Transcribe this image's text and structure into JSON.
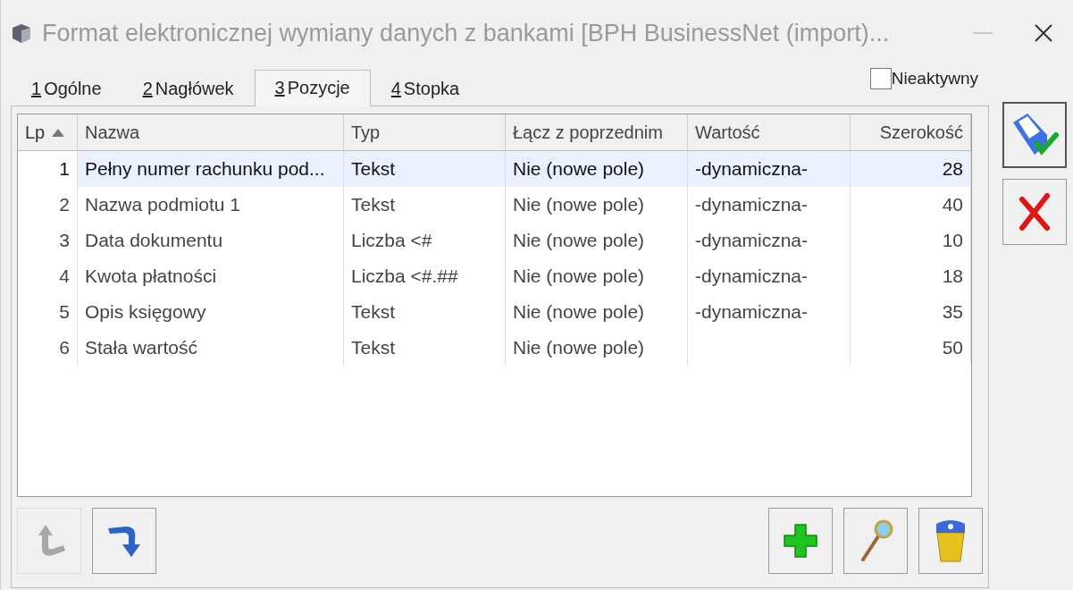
{
  "window": {
    "title": "Format elektronicznej wymiany danych z bankami [BPH BusinessNet (import)..."
  },
  "tabs": [
    {
      "key": "1",
      "label": "Ogólne",
      "selected": false
    },
    {
      "key": "2",
      "label": "Nagłówek",
      "selected": false
    },
    {
      "key": "3",
      "label": "Pozycje",
      "selected": true
    },
    {
      "key": "4",
      "label": "Stopka",
      "selected": false
    }
  ],
  "inactive_checkbox": {
    "label": "Nieaktywny",
    "checked": false
  },
  "table": {
    "columns": [
      {
        "label": "Lp",
        "sorted": true
      },
      {
        "label": "Nazwa",
        "sorted": false
      },
      {
        "label": "Typ",
        "sorted": false
      },
      {
        "label": "Łącz z poprzednim",
        "sorted": false
      },
      {
        "label": "Wartość",
        "sorted": false
      },
      {
        "label": "Szerokość",
        "sorted": false
      }
    ],
    "rows": [
      {
        "selected": true,
        "cells": [
          "1",
          "Pełny numer rachunku pod...",
          "Tekst",
          "Nie (nowe pole)",
          "-dynamiczna-",
          "28"
        ]
      },
      {
        "selected": false,
        "cells": [
          "2",
          "Nazwa podmiotu 1",
          "Tekst",
          "Nie (nowe pole)",
          "-dynamiczna-",
          "40"
        ]
      },
      {
        "selected": false,
        "cells": [
          "3",
          "Data dokumentu",
          "Liczba <#",
          "Nie (nowe pole)",
          "-dynamiczna-",
          "10"
        ]
      },
      {
        "selected": false,
        "cells": [
          "4",
          "Kwota płatności",
          "Liczba <#.##",
          "Nie (nowe pole)",
          "-dynamiczna-",
          "18"
        ]
      },
      {
        "selected": false,
        "cells": [
          "5",
          "Opis księgowy",
          "Tekst",
          "Nie (nowe pole)",
          "-dynamiczna-",
          "35"
        ]
      },
      {
        "selected": false,
        "cells": [
          "6",
          "Stała wartość",
          "Tekst",
          "Nie (nowe pole)",
          "",
          "50"
        ]
      }
    ]
  },
  "bottom_buttons": [
    {
      "kind": "up",
      "disabled": true
    },
    {
      "kind": "down",
      "disabled": false
    },
    {
      "kind": "add",
      "disabled": false
    },
    {
      "kind": "view",
      "disabled": false
    },
    {
      "kind": "delete",
      "disabled": false
    }
  ],
  "side_buttons": [
    {
      "kind": "save",
      "disabled": false
    },
    {
      "kind": "cancel",
      "disabled": false
    }
  ]
}
